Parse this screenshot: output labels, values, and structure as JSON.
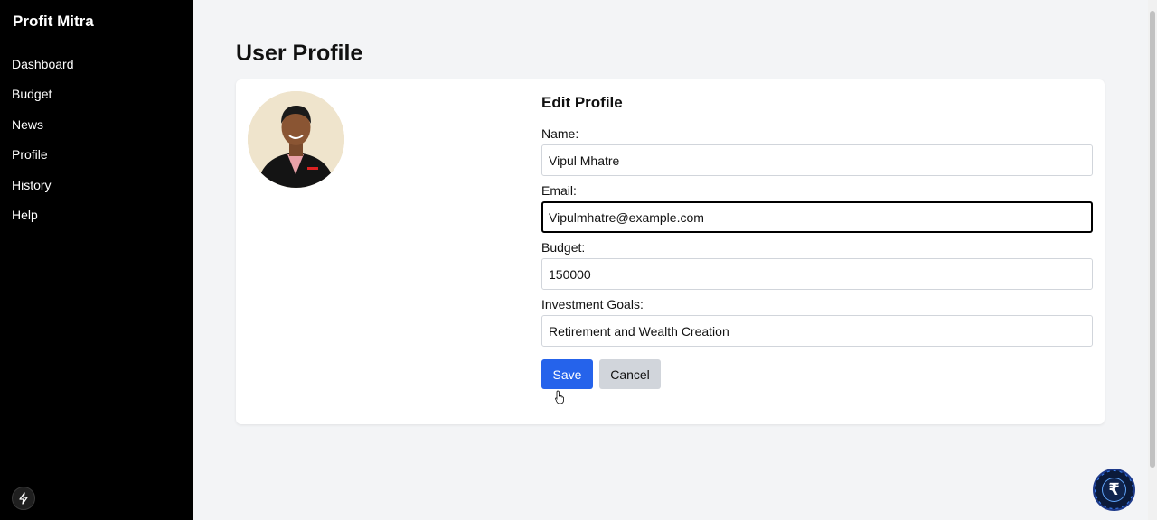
{
  "sidebar": {
    "brand": "Profit Mitra",
    "items": [
      {
        "label": "Dashboard"
      },
      {
        "label": "Budget"
      },
      {
        "label": "News"
      },
      {
        "label": "Profile"
      },
      {
        "label": "History"
      },
      {
        "label": "Help"
      }
    ],
    "footer_icon": "lightning-icon"
  },
  "page": {
    "title": "User Profile"
  },
  "profile": {
    "avatar_icon": "profile-photo",
    "form_title": "Edit Profile",
    "name_label": "Name:",
    "name_value": "Vipul Mhatre",
    "email_label": "Email:",
    "email_value": "Vipulmhatre@example.com",
    "budget_label": "Budget:",
    "budget_value": "150000",
    "goals_label": "Investment Goals:",
    "goals_value": "Retirement and Wealth Creation",
    "save_label": "Save",
    "cancel_label": "Cancel"
  },
  "fab": {
    "icon": "rupee-icon",
    "symbol": "₹"
  },
  "colors": {
    "sidebar_bg": "#000000",
    "page_bg": "#f3f4f6",
    "primary": "#2563eb",
    "cancel_bg": "#d1d5db"
  }
}
